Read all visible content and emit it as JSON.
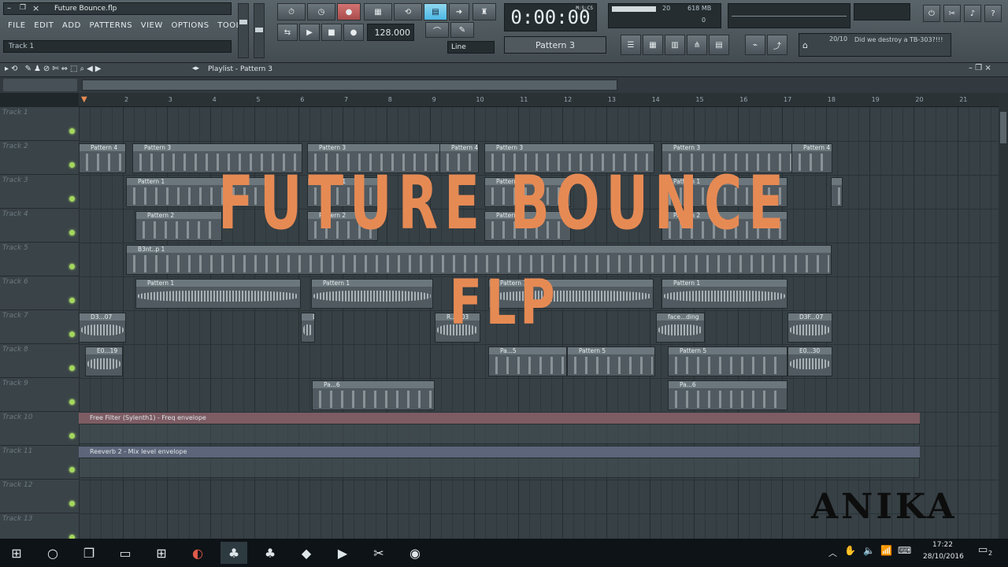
{
  "window": {
    "file_title": "Future Bounce.flp",
    "hint": "Track 1"
  },
  "menu": [
    "FILE",
    "EDIT",
    "ADD",
    "PATTERNS",
    "VIEW",
    "OPTIONS",
    "TOOLS",
    "?"
  ],
  "transport": {
    "tempo": "128.000",
    "time": "0:00:00",
    "time_unit": "M:S:CS",
    "snap": "Line",
    "pattern": "Pattern 3"
  },
  "monitor": {
    "cpu": "20",
    "memory": "618 MB",
    "poly": "0"
  },
  "hint_panel": {
    "counter": "20/10",
    "text": "Did we destroy a TB-303?!!!"
  },
  "playlist": {
    "title": "Playlist - Pattern 3"
  },
  "ruler": [
    "2",
    "3",
    "4",
    "5",
    "6",
    "7",
    "8",
    "9",
    "10",
    "11",
    "12",
    "13",
    "14",
    "15",
    "16",
    "17",
    "18",
    "19",
    "20",
    "21"
  ],
  "tracks": [
    "Track 1",
    "Track 2",
    "Track 3",
    "Track 4",
    "Track 5",
    "Track 6",
    "Track 7",
    "Track 8",
    "Track 9",
    "Track 10",
    "Track 11",
    "Track 12",
    "Track 13"
  ],
  "clips": {
    "pattern4": "Pattern 4",
    "pattern3": "Pattern 3",
    "pattern2": "Pattern 2",
    "pattern1": "Pattern 1",
    "pattern5": "Pattern 5",
    "pattern6": "Pattern 6",
    "b3nt": "B3nt..p 1",
    "pa5": "Pa...5",
    "pa6": "Pa...6",
    "d3_07": "D3...07",
    "e0_19": "E0...19",
    "e0_30": "E0...30",
    "face": "face...ding",
    "d3f": "D3F...07",
    "r_ll": "R...ll.03"
  },
  "automation": {
    "filter": "Free Filter (Sylenth1) - Freq envelope",
    "reverb": "Reeverb 2 - Mix level envelope"
  },
  "overlay": {
    "title_line1": "FUTURE BOUNCE",
    "title_line2": "FLP",
    "brand": "ANIKA"
  },
  "taskbar": {
    "time": "17:22",
    "date": "28/10/2016",
    "notif_count": "2"
  },
  "colors": {
    "accent": "#e68a54",
    "led": "#a4d75e",
    "lcd_blue": "#4db8e6"
  }
}
